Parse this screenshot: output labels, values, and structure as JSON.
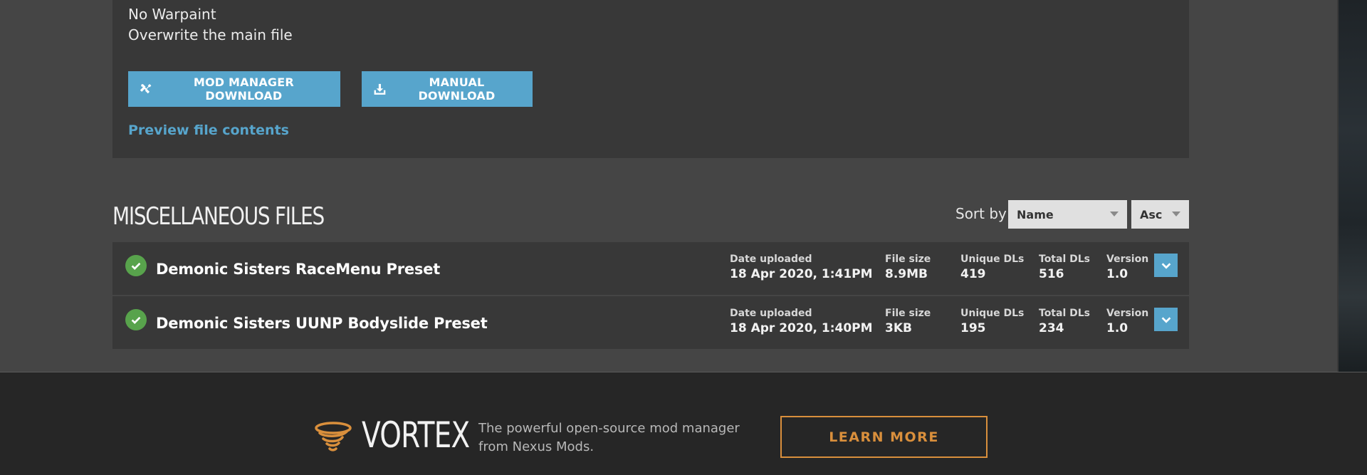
{
  "file_panel": {
    "description_lines": [
      "No Warpaint",
      "Overwrite the main file"
    ],
    "mod_manager_button": "MOD MANAGER DOWNLOAD",
    "manual_button": "MANUAL DOWNLOAD",
    "preview_link": "Preview file contents"
  },
  "misc_section": {
    "title": "MISCELLANEOUS FILES",
    "sort_label": "Sort by",
    "sort_field": "Name",
    "sort_order": "Asc"
  },
  "stat_labels": {
    "date": "Date uploaded",
    "size": "File size",
    "unique": "Unique DLs",
    "total": "Total DLs",
    "version": "Version"
  },
  "files": [
    {
      "name": "Demonic Sisters RaceMenu Preset",
      "date_uploaded": "18 Apr 2020, 1:41PM",
      "file_size": "8.9MB",
      "unique_dls": "419",
      "total_dls": "516",
      "version": "1.0"
    },
    {
      "name": "Demonic Sisters UUNP Bodyslide Preset",
      "date_uploaded": "18 Apr 2020, 1:40PM",
      "file_size": "3KB",
      "unique_dls": "195",
      "total_dls": "234",
      "version": "1.0"
    }
  ],
  "footer": {
    "brand": "VORTEX",
    "tagline_line1": "The powerful open-source mod manager",
    "tagline_line2": "from Nexus Mods.",
    "cta": "LEARN MORE"
  },
  "colors": {
    "accent_blue": "#57a5cc",
    "success_green": "#58a34c",
    "vortex_orange": "#d98f3c"
  }
}
